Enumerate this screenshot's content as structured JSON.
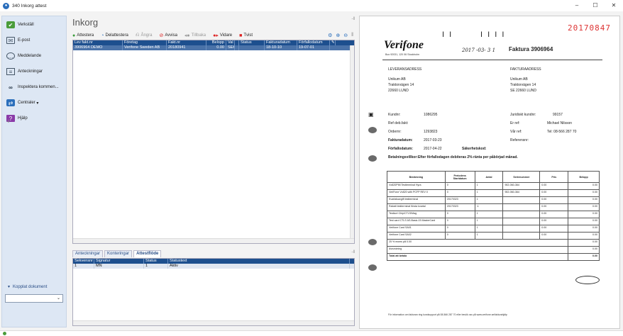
{
  "window": {
    "title": "340 Inkorg attest",
    "minimize": "–",
    "maximize": "☐",
    "close": "✕"
  },
  "sidebar": {
    "items": [
      {
        "label": "Verkställ",
        "icon": "check-icon"
      },
      {
        "label": "E-post",
        "icon": "mail-icon"
      },
      {
        "label": "Meddelande",
        "icon": "chat-icon"
      },
      {
        "label": "Anteckningar",
        "icon": "note-icon"
      },
      {
        "label": "Inspektera kommen...",
        "icon": "loop-icon"
      },
      {
        "label": "Centraler",
        "icon": "central-icon"
      },
      {
        "label": "Hjälp",
        "icon": "help-icon"
      }
    ],
    "pin": "-‖",
    "kopplat": "Kopplat dokument",
    "select_value": "⌄"
  },
  "main": {
    "title": "Inkorg",
    "pin": "-‖",
    "toolbar": {
      "attestera": "Attestera",
      "delattestera": "Delattestera",
      "angra": "Ångra",
      "avvisa": "Avvisa",
      "tillbaka": "Tillbaka",
      "vidare": "Vidare",
      "tvist": "Tvist"
    },
    "grid": {
      "headers": [
        "Lev fakt.nr",
        "Företag",
        "Fakt.nr",
        "Belopp",
        "Val",
        "",
        "Status",
        "Fakturadatum",
        "Förfallodatum"
      ],
      "row": [
        "3906964 DEMO",
        "Verifone Sweden AB",
        "20180941",
        "0.00",
        "SEK",
        "",
        "",
        "18-10-10",
        "19-07-01"
      ]
    },
    "tabs": [
      "Anteckningar",
      "Konteringar",
      "Attestflöde"
    ],
    "tabs_pin": "-‖",
    "subgrid": {
      "headers": [
        "Sekvensnr",
        "Signatur",
        "Status",
        "Statustext"
      ],
      "row": [
        "1",
        "MN",
        "1",
        "Aktiv"
      ]
    }
  },
  "document": {
    "number": "20170847",
    "marks_left": "I I",
    "marks_right": "I I  I  I",
    "logo": "Verifone",
    "logo_addr": "Box 92031, 120 06 Stockholm",
    "stamp": "2017 -03- 3 1",
    "faktura_title": "Faktura 3906964",
    "lev_head": "LEVERANSADRESS",
    "lev_lines": [
      "Unikum AB",
      "Traktorvägen 14",
      "22660  LUND"
    ],
    "fak_head": "FAKTURAADRESS",
    "fak_lines": [
      "Unikum AB",
      "Traktorvägen 14",
      "SE 22660 LUND"
    ],
    "kundnr_label": "Kundnr:",
    "kundnr": "1086295",
    "refdeb_label": "Ref deb.fakt:",
    "ordernr_label": "Ordernr:",
    "ordernr": "1293823",
    "fakturadatum_label": "Fakturadatum:",
    "fakturadatum": "2017-03-23",
    "forfallo_label": "Förfallodatum:",
    "forfallo": "2017-04-22",
    "sakerhet_label": "Säkerhetskod:",
    "betvillkor": "Betalningsvillkor:Efter förfallodagen debiteras 2% ränta per påbörjad månad.",
    "jur_label": "Juridiskt kundnr:",
    "jur": "99157",
    "erref_label": "Er ref:",
    "erref": "Michael Nilsson",
    "varref_label": "Vår ref:",
    "varref": "Tel: 08-566 287 70",
    "referensnr_label": "Referensnr:",
    "table_headers": [
      "Benämning",
      "Periodens Startdatum",
      "Antal",
      "Serienummer",
      "Pris",
      "Belopp"
    ],
    "table_rows": [
      [
        "Vx820PIM Testterminal Hyra",
        "0",
        "1",
        "902-060-364",
        "0.00",
        "0.00"
      ],
      [
        "VeriFone Vx820 with PCFP REV 0",
        "0",
        "1",
        "902-060-364",
        "0.00",
        "0.00"
      ],
      [
        "Kvartalsavgift testterminal",
        "20170323",
        "1",
        "",
        "0.00",
        "0.00"
      ],
      [
        "Rabatt testterminal första kvartal",
        "20170323",
        "-1",
        "",
        "0.00",
        "0.00"
      ],
      [
        "Testkort Chip/CTLS/Mag",
        "0",
        "1",
        "",
        "0.00",
        "0.00"
      ],
      [
        "Test card CTLS AS-Basic-03 MasterCard",
        "0",
        "1",
        "",
        "0.00",
        "0.00"
      ],
      [
        "Verifone Card SA01",
        "0",
        "1",
        "",
        "0.00",
        "0.00"
      ],
      [
        "Verifone Card SA02",
        "0",
        "1",
        "",
        "0.00",
        "0.00"
      ]
    ],
    "moms_label": "25 % moms på 0.00",
    "moms": "0.00",
    "avrundning_label": "Avrundning",
    "avrundning": "0.00",
    "total_label": "Total att betala",
    "total": "0.00",
    "footer": "För information om fakturan ring kundsupport på 08-566 287 70 eller besök oss på www.verifone.se/fakturahjälp"
  }
}
